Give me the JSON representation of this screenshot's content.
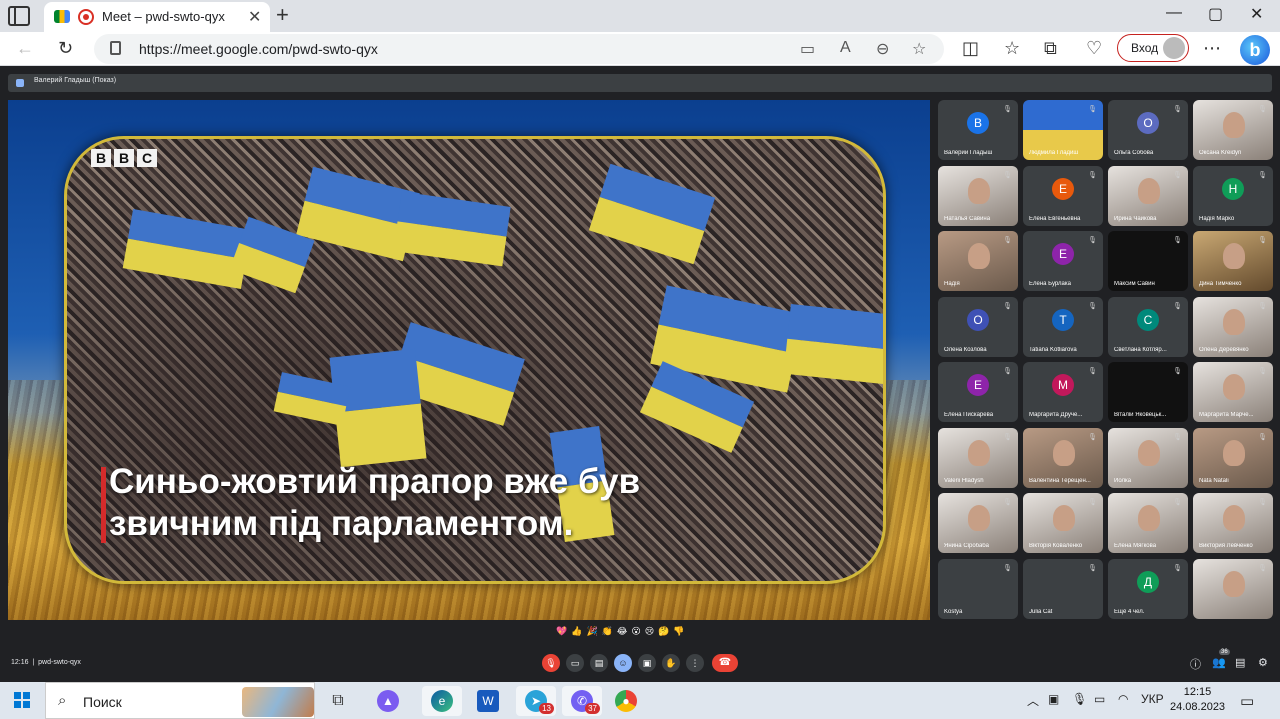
{
  "browser": {
    "tab_title": "Meet – pwd-swto-qyx",
    "tab_close": "✕",
    "new_tab": "+",
    "url": "https://meet.google.com/pwd-swto-qyx",
    "login_label": "Вход",
    "window_controls": [
      "—",
      "▢",
      "✕"
    ]
  },
  "meet": {
    "presenter_label": "Валерий Гладыш (Показ)",
    "video": {
      "logo_letters": [
        "B",
        "B",
        "C"
      ],
      "caption_line1": "Синьо-жовтий прапор вже був",
      "caption_line2": "звичним під парламентом."
    },
    "participants": [
      {
        "name": "Валерий Гладыш",
        "initial": "В",
        "color": "#1a73e8"
      },
      {
        "name": "Людмила Гладиш",
        "initial": "",
        "color": ""
      },
      {
        "name": "Ольга Собова",
        "initial": "О",
        "color": "#5c6bc0"
      },
      {
        "name": "Оксана Kreidyn",
        "initial": "",
        "color": ""
      },
      {
        "name": "Наталья Савина",
        "initial": "",
        "color": ""
      },
      {
        "name": "Елена Евгеньевна",
        "initial": "Е",
        "color": "#e8590c"
      },
      {
        "name": "Ирина Чайкова",
        "initial": "",
        "color": ""
      },
      {
        "name": "Надія Марко",
        "initial": "Н",
        "color": "#0f9d58"
      },
      {
        "name": "Надія",
        "initial": "",
        "color": ""
      },
      {
        "name": "Елена Бурлака",
        "initial": "Е",
        "color": "#8e24aa"
      },
      {
        "name": "Максим Савин",
        "initial": "",
        "color": ""
      },
      {
        "name": "Дина Тимченко",
        "initial": "",
        "color": ""
      },
      {
        "name": "Олена Козлова",
        "initial": "О",
        "color": "#3f51b5"
      },
      {
        "name": "Tatiana Kotliarova",
        "initial": "T",
        "color": "#1565c0"
      },
      {
        "name": "Светлана Котляр...",
        "initial": "С",
        "color": "#00897b"
      },
      {
        "name": "Олена Деревянко",
        "initial": "",
        "color": ""
      },
      {
        "name": "Елена Пискарева",
        "initial": "Е",
        "color": "#8e24aa"
      },
      {
        "name": "Маргарита Друче...",
        "initial": "М",
        "color": "#c2185b"
      },
      {
        "name": "Віталій Яковецьк...",
        "initial": "",
        "color": ""
      },
      {
        "name": "Маргарита Марче...",
        "initial": "",
        "color": ""
      },
      {
        "name": "Valerii Hladysh",
        "initial": "",
        "color": ""
      },
      {
        "name": "Валентина Терещен...",
        "initial": "",
        "color": ""
      },
      {
        "name": "Иолка",
        "initial": "",
        "color": ""
      },
      {
        "name": "Nata Natali",
        "initial": "",
        "color": ""
      },
      {
        "name": "Янина Сіробаба",
        "initial": "",
        "color": ""
      },
      {
        "name": "Вікторія Коваленко",
        "initial": "",
        "color": ""
      },
      {
        "name": "Елена Мягкова",
        "initial": "",
        "color": ""
      },
      {
        "name": "Виктория Левченко",
        "initial": "",
        "color": ""
      },
      {
        "name": "Kostya",
        "initial": "",
        "color": ""
      },
      {
        "name": "Julia Cat",
        "initial": "",
        "color": ""
      },
      {
        "name": "Ещё 4 чел.",
        "initial": "Д",
        "color": "#0f9d58"
      },
      {
        "name": "",
        "initial": "",
        "color": ""
      }
    ],
    "reactions": [
      "💖",
      "👍",
      "🎉",
      "👏",
      "😂",
      "😮",
      "😢",
      "🤔",
      "👎"
    ],
    "meeting_time": "12:16",
    "meeting_code": "pwd-swto-qyx",
    "participant_count": "36"
  },
  "taskbar": {
    "search_placeholder": "Поиск",
    "telegram_badge": "13",
    "viber_badge": "37",
    "language": "УКР",
    "time": "12:15",
    "date": "24.08.2023"
  }
}
